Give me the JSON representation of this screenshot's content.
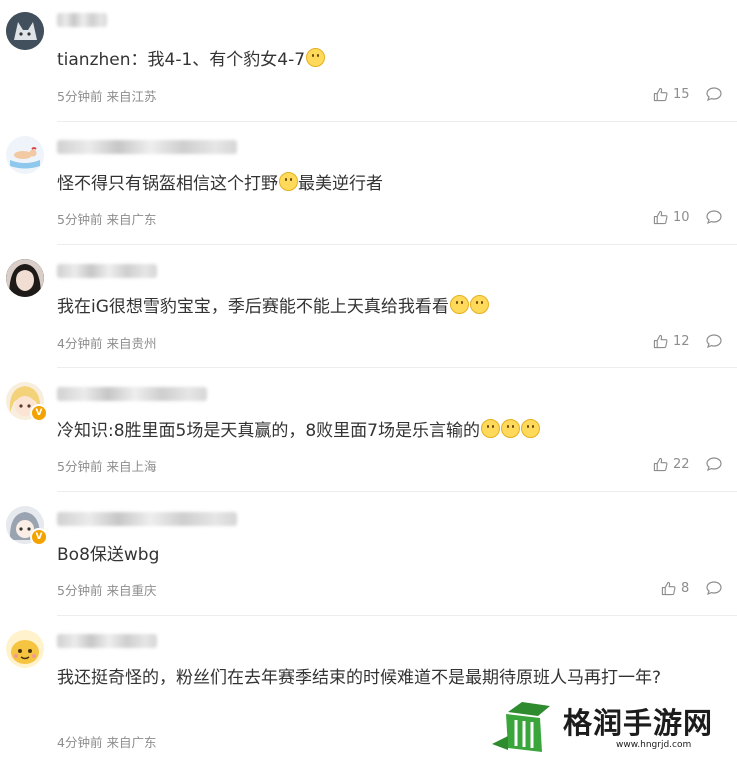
{
  "comments": [
    {
      "text": "tianzhen：我4-1、有个豹女4-7",
      "time": "5分钟前",
      "location": "来自江苏",
      "likes": "15",
      "emoji": 1,
      "avatar": "wolf-avatar",
      "verified": false
    },
    {
      "text": "怪不得只有锅盔相信这个打野",
      "text_after": "最美逆行者",
      "time": "5分钟前",
      "location": "来自广东",
      "likes": "10",
      "emoji": 1,
      "avatar": "cartoon-swimmer-avatar",
      "verified": false
    },
    {
      "text": "我在iG很想雪豹宝宝，季后赛能不能上天真给我看看",
      "time": "4分钟前",
      "location": "来自贵州",
      "likes": "12",
      "emoji": 2,
      "avatar": "girl-photo-avatar",
      "verified": false
    },
    {
      "text": "冷知识:8胜里面5场是天真赢的，8败里面7场是乐言输的",
      "time": "5分钟前",
      "location": "来自上海",
      "likes": "22",
      "emoji": 3,
      "avatar": "anime-girl-avatar",
      "verified": true
    },
    {
      "text": "Bo8保送wbg",
      "time": "5分钟前",
      "location": "来自重庆",
      "likes": "8",
      "emoji": 0,
      "avatar": "anime-hood-avatar",
      "verified": true
    },
    {
      "text": "我还挺奇怪的，粉丝们在去年赛季结束的时候难道不是最期待原班人马再打一年?",
      "time": "4分钟前",
      "location": "来自广东",
      "likes": "",
      "emoji": 0,
      "avatar": "yellow-cartoon-avatar",
      "verified": false
    }
  ],
  "watermark": {
    "name": "格润手游网",
    "url": "www.hngrjd.com"
  },
  "colors": {
    "text": "#333333",
    "meta": "#8d8d8d",
    "divider": "#ededed",
    "badge": "#f4a200",
    "logo_green": "#3aa53a"
  }
}
